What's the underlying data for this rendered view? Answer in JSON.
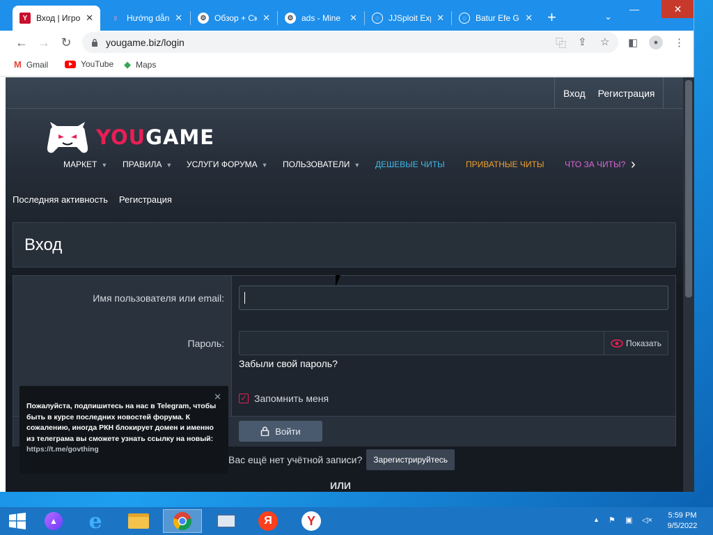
{
  "browser": {
    "tabs": [
      {
        "label": "Вход | Игро",
        "favicon": "Y",
        "active": true
      },
      {
        "label": "Hướng dẫn",
        "favicon": "heart",
        "active": false
      },
      {
        "label": "Обзор + Ск",
        "favicon": "gear",
        "active": false
      },
      {
        "label": "ads - Mine",
        "favicon": "gear",
        "active": false
      },
      {
        "label": "JJSploit Exp",
        "favicon": "globe",
        "active": false
      },
      {
        "label": "Batur Efe G",
        "favicon": "globe",
        "active": false
      }
    ],
    "url": "yougame.biz/login",
    "bookmarks": [
      {
        "label": "Gmail",
        "icon": "gmail-icon"
      },
      {
        "label": "YouTube",
        "icon": "youtube-icon"
      },
      {
        "label": "Maps",
        "icon": "maps-icon"
      }
    ]
  },
  "site": {
    "topbar": {
      "login": "Вход",
      "register": "Регистрация"
    },
    "logo": {
      "part1": "YOU",
      "part2": "GAME"
    },
    "nav": [
      {
        "label": "МАРКЕТ",
        "dropdown": true,
        "color": "#ffffff"
      },
      {
        "label": "ПРАВИЛА",
        "dropdown": true,
        "color": "#ffffff"
      },
      {
        "label": "УСЛУГИ ФОРУМА",
        "dropdown": true,
        "color": "#ffffff"
      },
      {
        "label": "ПОЛЬЗОВАТЕЛИ",
        "dropdown": true,
        "color": "#ffffff"
      },
      {
        "label": "ДЕШЕВЫЕ ЧИТЫ",
        "dropdown": false,
        "color": "#3fb8e8"
      },
      {
        "label": "ПРИВАТНЫЕ ЧИТЫ",
        "dropdown": false,
        "color": "#f0a030"
      },
      {
        "label": "ЧТО ЗА ЧИТЫ?",
        "dropdown": false,
        "color": "#d966d6"
      }
    ],
    "subnav": {
      "recent": "Последняя активность",
      "register": "Регистрация"
    },
    "page_title": "Вход",
    "form": {
      "username_label": "Имя пользователя или email:",
      "username_value": "",
      "password_label": "Пароль:",
      "password_value": "",
      "show_label": "Показать",
      "forgot": "Забыли свой пароль?",
      "remember": "Запомнить меня",
      "remember_checked": true,
      "submit": "Войти"
    },
    "no_account": "Вас ещё нет учётной записи?",
    "register_button": "Зарегистрируйтесь",
    "or": "ИЛИ",
    "telegram_popup": {
      "text": "Пожалуйста, подпишитесь на нас в Telegram, чтобы быть в курсе последних новостей форума. К сожалению, иногда РКН блокирует домен и именно из телеграма вы сможете узнать ссылку на новый: ",
      "link": "https://t.me/govthing"
    }
  },
  "taskbar": {
    "time": "5:59 PM",
    "date": "9/5/2022"
  },
  "colors": {
    "accent": "#e91e55",
    "tabstrip": "#1e8fea"
  }
}
